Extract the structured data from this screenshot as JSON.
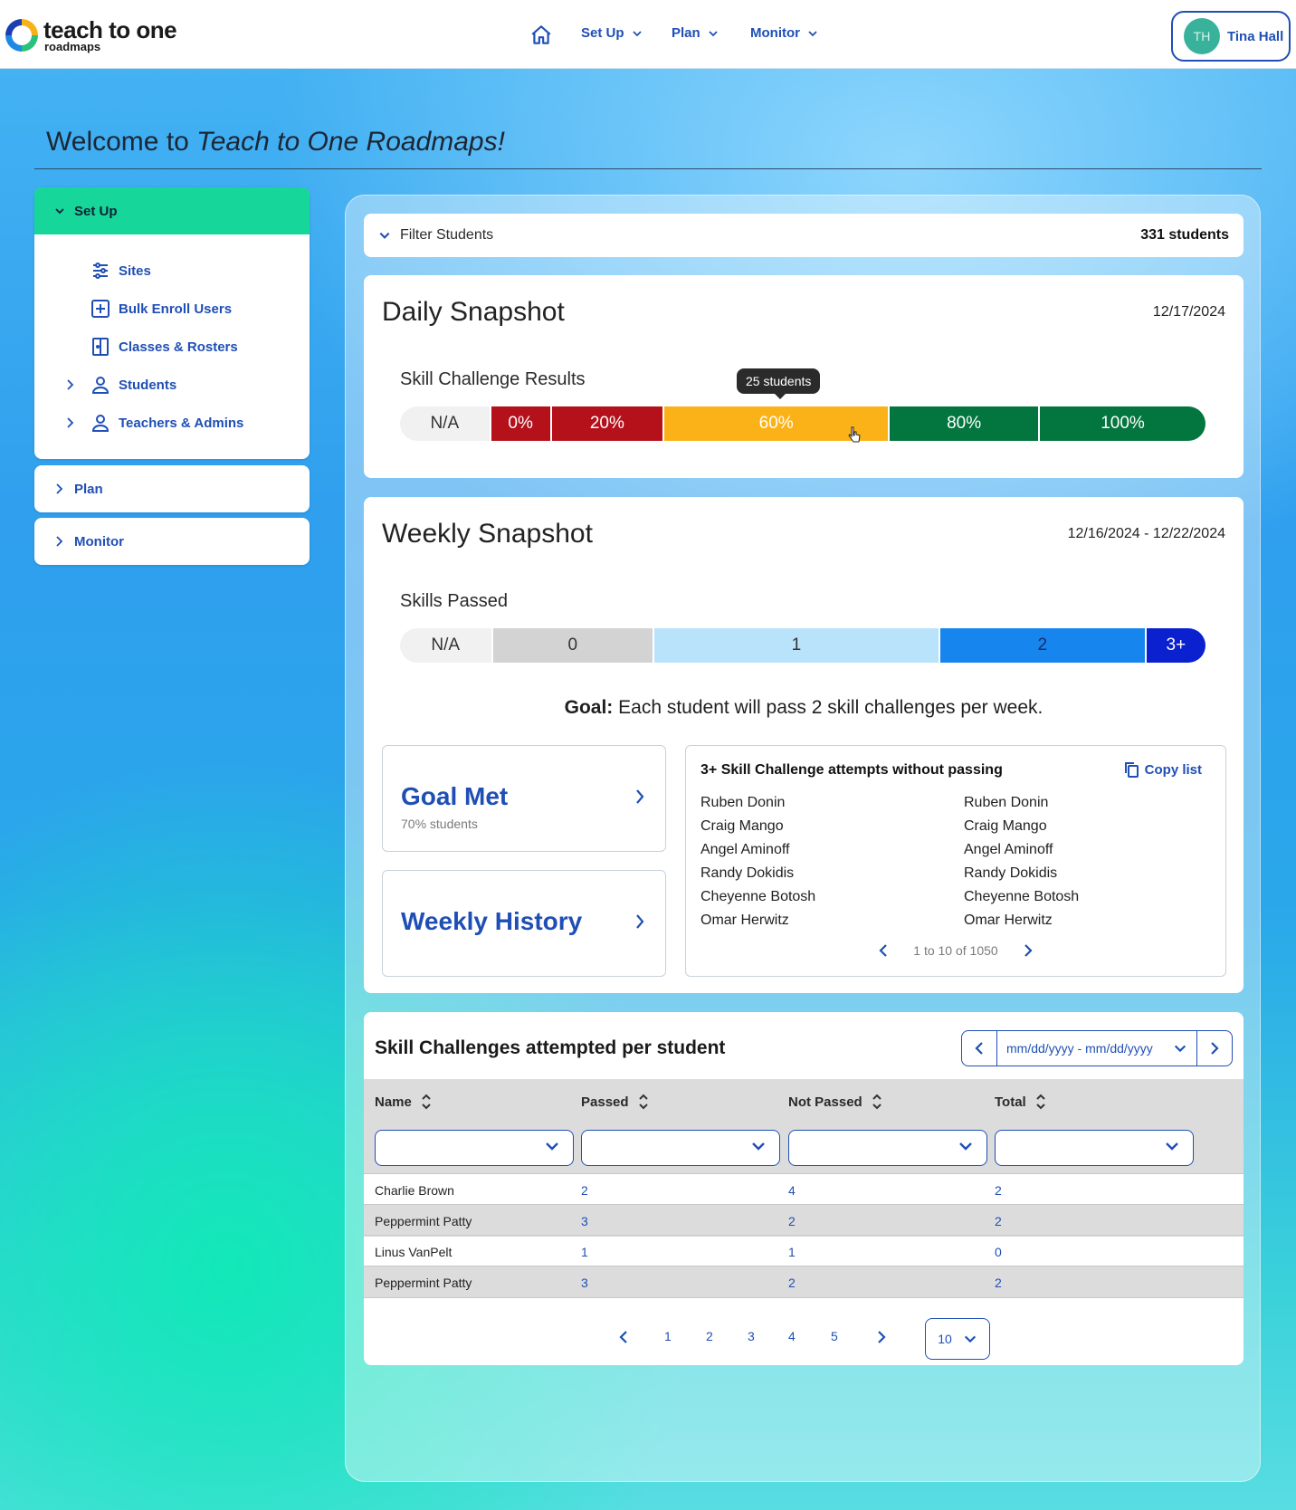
{
  "header": {
    "logo_main": "teach to one",
    "logo_sub": "roadmaps",
    "nav": [
      {
        "label": "Set Up"
      },
      {
        "label": "Plan"
      },
      {
        "label": "Monitor"
      }
    ],
    "user": {
      "initials": "TH",
      "name": "Tina Hall"
    }
  },
  "welcome": {
    "prefix": "Welcome to ",
    "emphasis": "Teach to One Roadmaps!"
  },
  "sidebar": {
    "setup_label": "Set Up",
    "setup_items": [
      {
        "label": "Sites",
        "icon": "sliders-icon",
        "expandable": false
      },
      {
        "label": "Bulk Enroll Users",
        "icon": "plus-square-icon",
        "expandable": false
      },
      {
        "label": "Classes & Rosters",
        "icon": "door-icon",
        "expandable": false
      },
      {
        "label": "Students",
        "icon": "person-icon",
        "expandable": true
      },
      {
        "label": "Teachers & Admins",
        "icon": "person-icon",
        "expandable": true
      }
    ],
    "plan_label": "Plan",
    "monitor_label": "Monitor"
  },
  "filter": {
    "label": "Filter Students",
    "count": "331 students"
  },
  "daily": {
    "title": "Daily Snapshot",
    "date": "12/17/2024",
    "bar_label": "Skill Challenge Results",
    "tooltip": "25 students",
    "segments": [
      {
        "label": "N/A",
        "share": 0.112,
        "color": "#f1f1f1",
        "text_color": "#333333"
      },
      {
        "label": "0%",
        "share": 0.074,
        "color": "#b5111b",
        "text_color": "#ffffff"
      },
      {
        "label": "20%",
        "share": 0.139,
        "color": "#b5111b",
        "text_color": "#ffffff"
      },
      {
        "label": "60%",
        "share": 0.281,
        "color": "#fbb219",
        "text_color": "#ffffff"
      },
      {
        "label": "80%",
        "share": 0.186,
        "color": "#03763f",
        "text_color": "#ffffff"
      },
      {
        "label": "100%",
        "share": 0.208,
        "color": "#03763f",
        "text_color": "#ffffff"
      }
    ]
  },
  "weekly": {
    "title": "Weekly Snapshot",
    "date_range": "12/16/2024 - 12/22/2024",
    "bar_label": "Skills Passed",
    "segments": [
      {
        "label": "N/A",
        "share": 0.114,
        "color": "#f1f1f1",
        "text_color": "#333333"
      },
      {
        "label": "0",
        "share": 0.2,
        "color": "#d3d3d3",
        "text_color": "#333333"
      },
      {
        "label": "1",
        "share": 0.356,
        "color": "#b9e2fb",
        "text_color": "#333333"
      },
      {
        "label": "2",
        "share": 0.256,
        "color": "#1685ee",
        "text_color": "#1a2b6b"
      },
      {
        "label": "3+",
        "share": 0.074,
        "color": "#0b21cf",
        "text_color": "#ffffff"
      }
    ],
    "goal_prefix": "Goal:",
    "goal_text": " Each student will pass 2 skill challenges per week.",
    "goal_met": {
      "title": "Goal Met",
      "note": "70% students"
    },
    "weekly_history": {
      "title": "Weekly History"
    },
    "attempts": {
      "title": "3+ Skill Challenge attempts without passing",
      "copy_label": "Copy list",
      "col1": [
        "Ruben Donin",
        "Craig Mango",
        "Angel Aminoff",
        "Randy Dokidis",
        "Cheyenne Botosh",
        "Omar Herwitz"
      ],
      "col2": [
        "Ruben Donin",
        "Craig Mango",
        "Angel Aminoff",
        "Randy Dokidis",
        "Cheyenne Botosh",
        "Omar Herwitz"
      ],
      "pager_text": "1 to 10 of 1050"
    }
  },
  "table": {
    "title": "Skill Challenges attempted per student",
    "date_placeholder": "mm/dd/yyyy - mm/dd/yyyy",
    "columns": [
      "Name",
      "Passed",
      "Not Passed",
      "Total"
    ],
    "rows": [
      [
        "Charlie Brown",
        "2",
        "4",
        "2"
      ],
      [
        "Peppermint Patty",
        "3",
        "2",
        "2"
      ],
      [
        "Linus VanPelt",
        "1",
        "1",
        "0"
      ],
      [
        "Peppermint Patty",
        "3",
        "2",
        "2"
      ]
    ],
    "pages": [
      "1",
      "2",
      "3",
      "4",
      "5"
    ],
    "page_size": "10"
  }
}
